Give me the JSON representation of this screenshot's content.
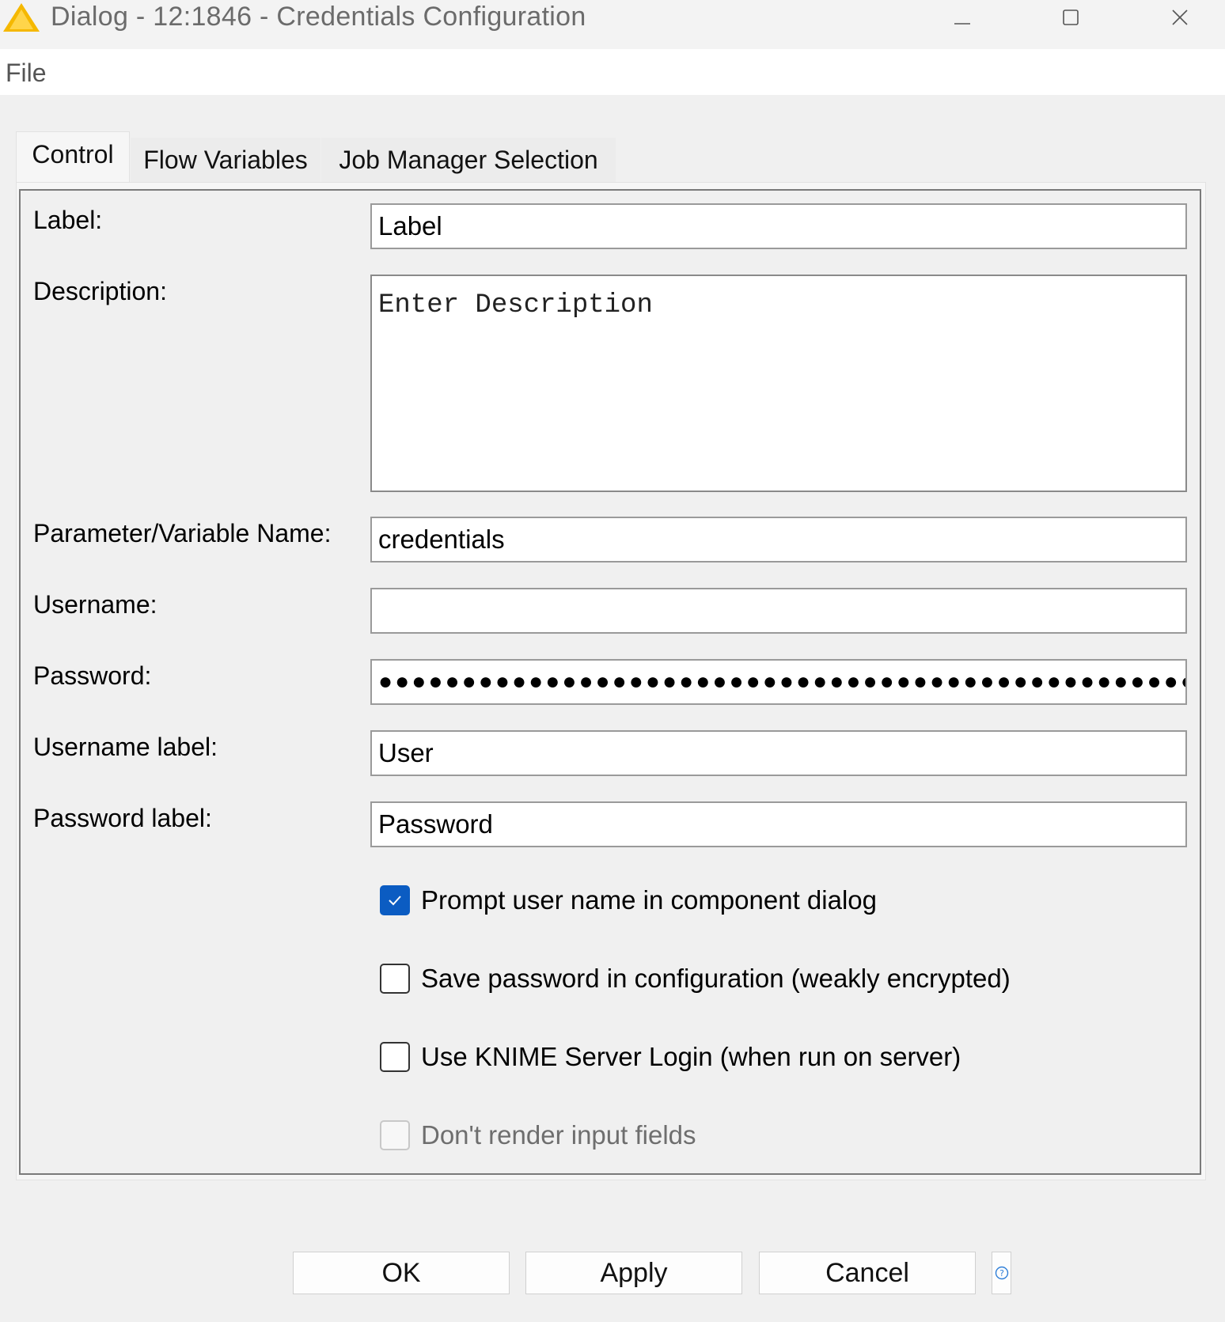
{
  "window": {
    "title": "Dialog - 12:1846 - Credentials Configuration",
    "icon": "knime-warning-triangle-icon",
    "controls": [
      "minimize-icon",
      "maximize-icon",
      "close-icon"
    ]
  },
  "menu": {
    "file": "File"
  },
  "tabs": [
    {
      "label": "Control",
      "active": true
    },
    {
      "label": "Flow Variables",
      "active": false
    },
    {
      "label": "Job Manager Selection",
      "active": false
    }
  ],
  "form": {
    "label": {
      "caption": "Label:",
      "value": "Label"
    },
    "description": {
      "caption": "Description:",
      "value": "Enter Description"
    },
    "parameter_name": {
      "caption": "Parameter/Variable Name:",
      "value": "credentials"
    },
    "username": {
      "caption": "Username:",
      "value": ""
    },
    "password": {
      "caption": "Password:",
      "value": "●●●●●●●●●●●●●●●●●●●●●●●●●●●●●●●●●●●●●●●●●●●●●●●●●●●●●●●"
    },
    "username_label": {
      "caption": "Username label:",
      "value": "User"
    },
    "password_label": {
      "caption": "Password label:",
      "value": "Password"
    }
  },
  "options": [
    {
      "label": "Prompt user name in component dialog",
      "checked": true,
      "enabled": true
    },
    {
      "label": "Save password in configuration (weakly encrypted)",
      "checked": false,
      "enabled": true
    },
    {
      "label": "Use KNIME Server Login (when run on server)",
      "checked": false,
      "enabled": true
    },
    {
      "label": "Don't render input fields",
      "checked": false,
      "enabled": false
    }
  ],
  "buttons": {
    "ok": "OK",
    "apply": "Apply",
    "cancel": "Cancel",
    "help_icon": "help-icon"
  },
  "colors": {
    "accent": "#0b5cc2",
    "warning_icon": "#f5b800"
  }
}
